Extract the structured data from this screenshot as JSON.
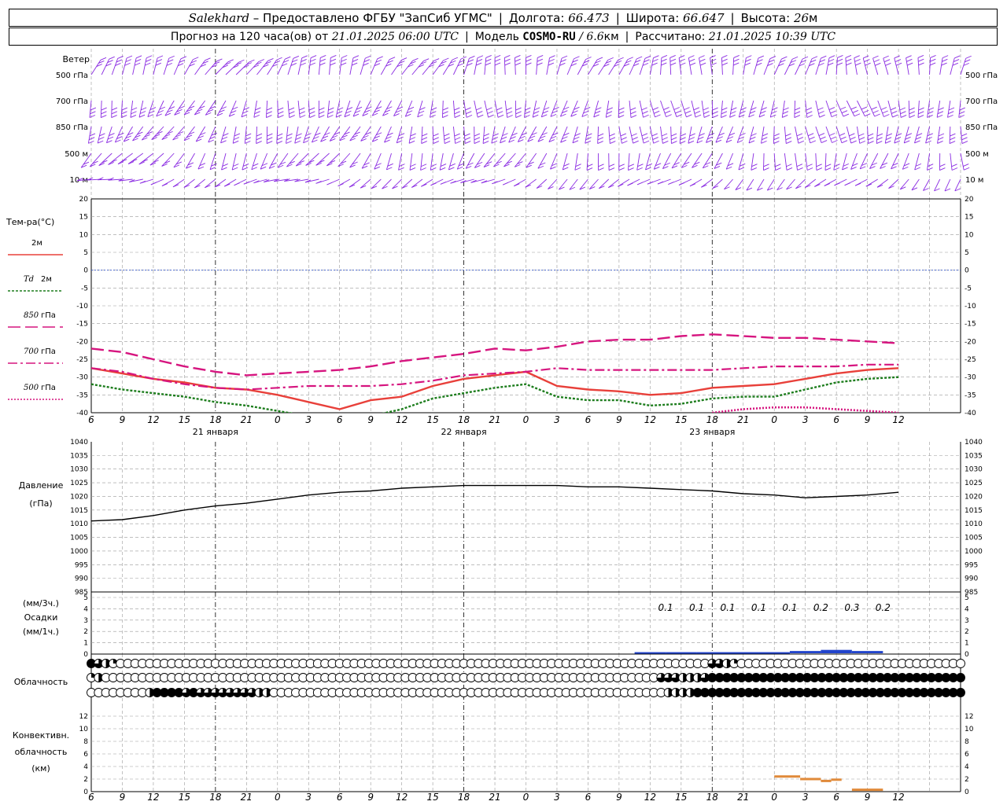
{
  "header": {
    "station": "Salekhard",
    "provider": "– Предоставлено ФГБУ \"ЗапСиб УГМС\"",
    "lon_label": "Долгота:",
    "lon_value": "66.473",
    "lat_label": "Широта:",
    "lat_value": "66.647",
    "alt_label": "Высота:",
    "alt_value": "26",
    "alt_unit": "м",
    "forecast_label": "Прогноз на 120 часа(ов) от",
    "forecast_from": "21.01.2025 06:00 UTC",
    "model_label": "Модель",
    "model_name": "COSMO-RU",
    "model_res": "/ 6.6",
    "model_res_unit": "км",
    "computed_label": "Рассчитано:",
    "computed_at": "21.01.2025 10:39 UTC"
  },
  "time_axis": {
    "hour_ticks": [
      "6",
      "9",
      "12",
      "15",
      "18",
      "21",
      "0",
      "3",
      "6",
      "9",
      "12",
      "15",
      "18",
      "21",
      "0",
      "3",
      "6",
      "9",
      "12",
      "15",
      "18",
      "21",
      "0",
      "3",
      "6",
      "9",
      "12"
    ],
    "day_labels": [
      {
        "text": "21 января",
        "at_hour": 6
      },
      {
        "text": "22 января",
        "at_hour": 30
      },
      {
        "text": "23 января",
        "at_hour": 54
      }
    ],
    "day_boundaries_hours": [
      18,
      42,
      66
    ]
  },
  "wind_panel": {
    "title": "Ветер",
    "levels": [
      "500 гПа",
      "700 гПа",
      "850 гПа",
      "500 м",
      "10  м"
    ],
    "right_levels": [
      "500 гПа",
      "700 гПа",
      "850 гПа",
      "500 м",
      "10  м"
    ]
  },
  "temp_legend": {
    "title": "Тем-ра(°С)",
    "items": [
      {
        "prefix": "",
        "label": "2м",
        "color": "#e8403a",
        "dash": "solid"
      },
      {
        "prefix": "Td",
        "label": "2м",
        "color": "#1d7d1d",
        "dash": "short"
      },
      {
        "prefix": "850",
        "label": "гПа",
        "color": "#d6157f",
        "dash": "long"
      },
      {
        "prefix": "700",
        "label": "гПа",
        "color": "#d6157f",
        "dash": "dashdot"
      },
      {
        "prefix": "500",
        "label": "гПа",
        "color": "#d6157f",
        "dash": "dot"
      }
    ]
  },
  "pressure_labels": {
    "title": "Давление",
    "unit": "(гПа)"
  },
  "precip_labels": {
    "unit3": "(мм/3ч.)",
    "title": "Осадки",
    "unit1": "(мм/1ч.)"
  },
  "precip_values": [
    {
      "hour": 60,
      "text": "0.1"
    },
    {
      "hour": 63,
      "text": "0.1"
    },
    {
      "hour": 66,
      "text": "0.1"
    },
    {
      "hour": 69,
      "text": "0.1"
    },
    {
      "hour": 72,
      "text": "0.1"
    },
    {
      "hour": 75,
      "text": "0.2"
    },
    {
      "hour": 78,
      "text": "0.3"
    },
    {
      "hour": 81,
      "text": "0.2"
    }
  ],
  "cloud_label": "Облачность",
  "conv_labels": [
    "Конвективн.",
    "облачность",
    "(км)"
  ],
  "colors": {
    "t2m": "#e8403a",
    "td2m": "#1d7d1d",
    "upper": "#d6157f",
    "zero_line": "#3355cc",
    "pressure": "#000000",
    "precip": "#2244cc",
    "conv": "#e08a3a",
    "wind": "#8a2be2",
    "grid": "#999999"
  },
  "chart_data": [
    {
      "type": "line",
      "title": "Тем-ра(°С)",
      "x_unit": "hours since 21.01.2025 00 UTC",
      "ylim": [
        -40,
        20
      ],
      "yticks": [
        20,
        15,
        10,
        5,
        0,
        -5,
        -10,
        -15,
        -20,
        -25,
        -30,
        -35,
        -40
      ],
      "x": [
        6,
        9,
        12,
        15,
        18,
        21,
        24,
        27,
        30,
        33,
        36,
        39,
        42,
        45,
        48,
        51,
        54,
        57,
        60,
        63,
        66,
        69,
        72,
        75,
        78,
        81,
        84,
        87,
        90
      ],
      "series": [
        {
          "name": "2м",
          "values": [
            -27.5,
            -29,
            -30.5,
            -31.5,
            -33,
            -33.5,
            -35,
            -37,
            -39,
            -36.5,
            -35.5,
            -32.5,
            -30.5,
            -29.5,
            -28.5,
            -32.5,
            -33.5,
            -34,
            -35,
            -34.5,
            -33,
            -32.5,
            -32,
            -30.5,
            -29,
            -28,
            -27.5
          ]
        },
        {
          "name": "Td 2м",
          "values": [
            -32,
            -33.5,
            -34.5,
            -35.5,
            -37,
            -38,
            -39.5,
            -41,
            -43,
            -41,
            -39,
            -36,
            -34.5,
            -33,
            -32,
            -35.5,
            -36.5,
            -36.5,
            -38,
            -37.5,
            -36,
            -35.5,
            -35.5,
            -33.5,
            -31.5,
            -30.5,
            -30
          ]
        },
        {
          "name": "850 гПа",
          "values": [
            -22,
            -23,
            -25,
            -27,
            -28.5,
            -29.5,
            -29,
            -28.5,
            -28,
            -27,
            -25.5,
            -24.5,
            -23.5,
            -22,
            -22.5,
            -21.5,
            -20,
            -19.5,
            -19.5,
            -18.5,
            -18,
            -18.5,
            -19,
            -19,
            -19.5,
            -20,
            -20.5
          ]
        },
        {
          "name": "700 гПа",
          "values": [
            -27.5,
            -28.5,
            -30.5,
            -32,
            -33,
            -33.5,
            -33,
            -32.5,
            -32.5,
            -32.5,
            -32,
            -31,
            -29.5,
            -29,
            -28.5,
            -27.5,
            -28,
            -28,
            -28,
            -28,
            -28,
            -27.5,
            -27,
            -27,
            -27,
            -26.5,
            -26.5
          ]
        },
        {
          "name": "500 гПа",
          "values": [
            null,
            null,
            null,
            null,
            null,
            null,
            null,
            null,
            null,
            null,
            null,
            null,
            null,
            null,
            null,
            null,
            null,
            null,
            null,
            null,
            -40,
            -39,
            -38.5,
            -38.5,
            -39,
            -39.5,
            -40
          ]
        }
      ]
    },
    {
      "type": "line",
      "title": "Давление",
      "ylabel": "(гПа)",
      "ylim": [
        985,
        1040
      ],
      "yticks": [
        1040,
        1035,
        1030,
        1025,
        1020,
        1015,
        1010,
        1005,
        1000,
        995,
        990,
        985
      ],
      "x": [
        6,
        9,
        12,
        15,
        18,
        21,
        24,
        27,
        30,
        33,
        36,
        39,
        42,
        45,
        48,
        51,
        54,
        57,
        60,
        63,
        66,
        69,
        72,
        75,
        78,
        81,
        84
      ],
      "series": [
        {
          "name": "",
          "values": [
            1011,
            1011.5,
            1013,
            1015,
            1016.5,
            1017.5,
            1019,
            1020.5,
            1021.5,
            1022,
            1023,
            1023.5,
            1024,
            1024,
            1024,
            1024,
            1023.5,
            1023.5,
            1023,
            1022.5,
            1022,
            1021,
            1020.5,
            1019.5,
            1020,
            1020.5,
            1021.5
          ]
        }
      ]
    },
    {
      "type": "bar",
      "title": "Осадки",
      "ylabel": "(мм/3ч.)",
      "ylim": [
        0,
        5
      ],
      "yticks": [
        5,
        4,
        3,
        2,
        1,
        0
      ],
      "x": [
        60,
        63,
        66,
        69,
        72,
        75,
        78,
        81
      ],
      "values": [
        0.1,
        0.1,
        0.1,
        0.1,
        0.1,
        0.2,
        0.3,
        0.2
      ]
    },
    {
      "type": "table",
      "title": "Облачность",
      "x_step_hours": 1,
      "rows": [
        {
          "level": "upper",
          "cover": [
            1,
            0.75,
            0.5,
            0.25,
            0,
            0,
            0,
            0,
            0,
            0,
            0,
            0,
            0,
            0,
            0,
            0,
            0,
            0,
            0,
            0,
            0,
            0,
            0,
            0,
            0,
            0,
            0,
            0,
            0,
            0,
            0,
            0,
            0,
            0,
            0,
            0,
            0,
            0,
            0,
            0,
            0,
            0,
            0,
            0,
            0,
            0,
            0,
            0,
            0,
            0,
            0,
            0,
            0,
            0,
            0,
            0,
            0,
            0,
            0,
            0,
            0,
            0,
            0,
            0,
            0,
            0,
            0,
            0,
            0,
            0,
            0,
            0,
            0,
            0,
            0,
            0,
            0,
            0,
            0,
            0,
            0,
            0,
            0,
            0,
            0,
            0.75,
            0.75,
            0.5,
            0.25,
            0,
            0,
            0,
            0,
            0,
            0,
            0,
            0,
            0,
            0,
            0,
            0,
            0,
            0,
            0,
            0,
            0,
            0,
            0,
            0,
            0,
            0,
            0,
            0,
            0,
            0,
            0,
            0,
            0,
            0,
            0,
            0,
            0,
            0
          ]
        },
        {
          "level": "middle",
          "cover": [
            0.25,
            0.5,
            0,
            0,
            0,
            0,
            0,
            0,
            0,
            0,
            0,
            0,
            0,
            0,
            0,
            0,
            0,
            0,
            0,
            0,
            0,
            0,
            0,
            0,
            0,
            0,
            0,
            0,
            0,
            0,
            0,
            0,
            0,
            0,
            0,
            0,
            0,
            0,
            0,
            0,
            0,
            0,
            0,
            0,
            0,
            0,
            0,
            0,
            0,
            0,
            0,
            0,
            0,
            0,
            0,
            0,
            0,
            0,
            0,
            0,
            0,
            0,
            0,
            0,
            0,
            0,
            0,
            0,
            0,
            0,
            0,
            0,
            0,
            0,
            0,
            0,
            0,
            0,
            0.75,
            0.75,
            0.75,
            0.5,
            0.5,
            0.5,
            0.75,
            1,
            1,
            1,
            1,
            1,
            1,
            1,
            1,
            1,
            1,
            1,
            1,
            1,
            1,
            1,
            1,
            1,
            1,
            1,
            1,
            1,
            1,
            1,
            1,
            1,
            1,
            1,
            1,
            1,
            1,
            1,
            1,
            1,
            1,
            1,
            1,
            1,
            1
          ]
        },
        {
          "level": "lower",
          "cover": [
            0,
            0,
            0,
            0,
            0,
            0,
            0,
            0,
            0.5,
            1,
            1,
            1,
            1,
            0.75,
            1,
            0.75,
            0.75,
            0.75,
            0.75,
            0.75,
            0.75,
            0.75,
            0.75,
            0.5,
            0.5,
            0,
            0,
            0,
            0,
            0,
            0,
            0,
            0,
            0,
            0,
            0,
            0,
            0,
            0,
            0,
            0,
            0,
            0,
            0,
            0,
            0,
            0,
            0,
            0,
            0,
            0,
            0,
            0,
            0,
            0,
            0,
            0,
            0,
            0,
            0,
            0,
            0,
            0,
            0,
            0,
            0,
            0,
            0,
            0,
            0,
            0,
            0,
            0,
            0,
            0,
            0,
            0,
            0,
            0,
            0.5,
            0.5,
            0.5,
            0.5,
            1,
            1,
            1,
            1,
            1,
            1,
            1,
            1,
            1,
            1,
            1,
            1,
            1,
            1,
            1,
            1,
            1,
            1,
            1,
            1,
            1,
            1,
            1,
            1,
            1,
            1,
            1,
            1,
            1,
            1,
            1,
            1,
            1,
            1,
            1,
            1,
            1,
            1,
            1,
            1,
            1,
            1,
            1,
            1,
            1,
            1,
            1
          ]
        }
      ]
    },
    {
      "type": "line",
      "title": "Конвективн. облачность",
      "ylabel": "(км)",
      "ylim": [
        0,
        13
      ],
      "yticks": [
        12,
        10,
        8,
        6,
        4,
        2,
        0
      ],
      "segments": [
        {
          "x0": 72,
          "x1": 74.5,
          "y": 2.4
        },
        {
          "x0": 74.5,
          "x1": 76.5,
          "y": 2.0
        },
        {
          "x0": 76.5,
          "x1": 77.5,
          "y": 1.7
        },
        {
          "x0": 77.5,
          "x1": 78.5,
          "y": 1.9
        },
        {
          "x0": 79.5,
          "x1": 82.5,
          "y": 0.3
        }
      ]
    }
  ]
}
